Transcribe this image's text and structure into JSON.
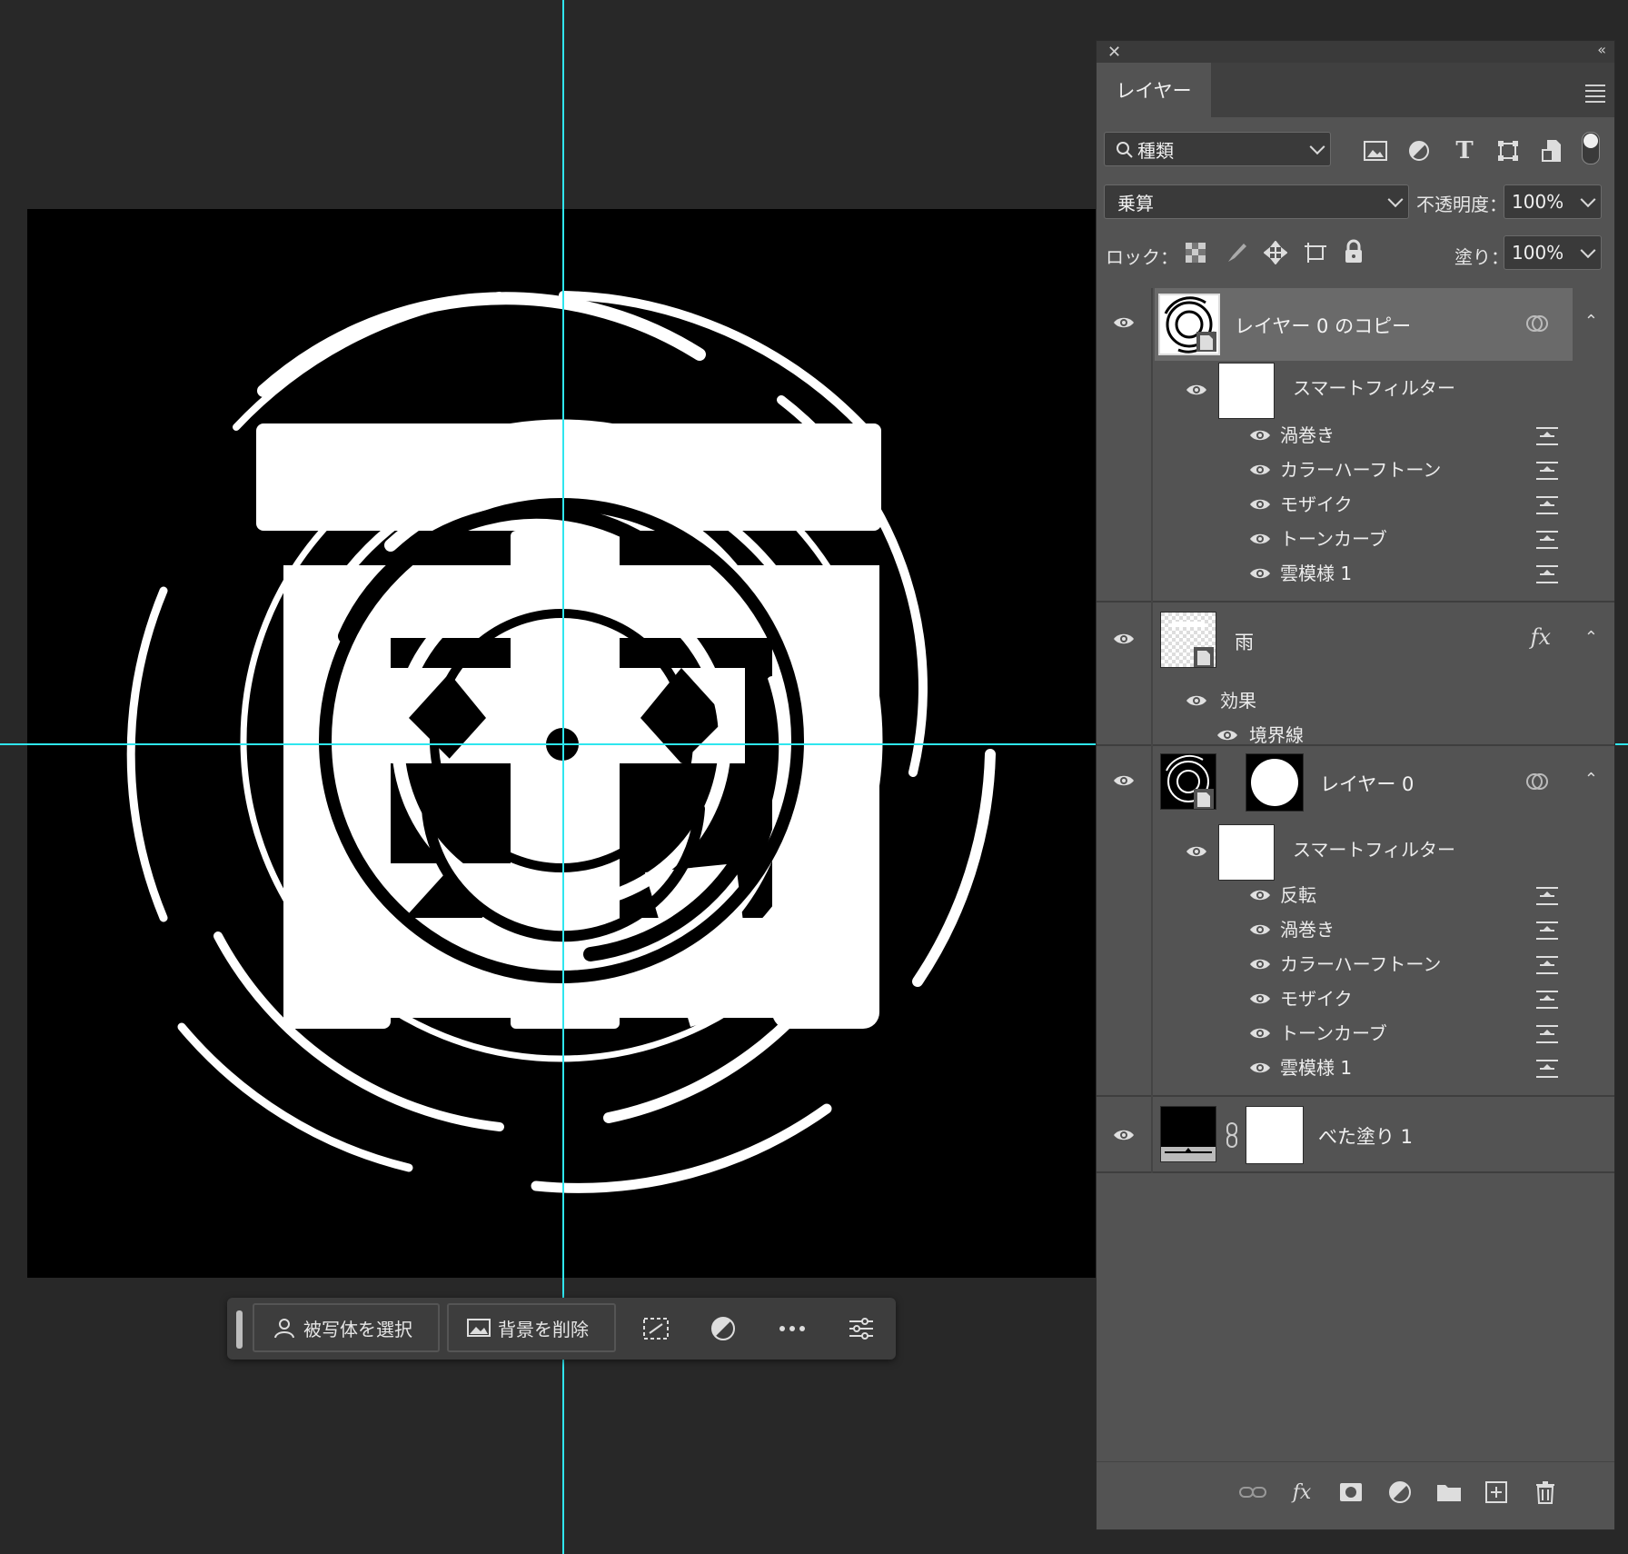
{
  "taskbar": {
    "select_subject_label": "被写体を選択",
    "remove_bg_label": "背景を削除"
  },
  "layers_panel": {
    "tab_label": "レイヤー",
    "filter_kind": "種類",
    "blend_mode": "乗算",
    "opacity_label": "不透明度：",
    "opacity_value": "100%",
    "lock_label": "ロック：",
    "fill_label": "塗り：",
    "fill_value": "100%",
    "layers": [
      {
        "name": "レイヤー 0 のコピー",
        "smart_filter_label": "スマートフィルター",
        "filters": [
          "渦巻き",
          "カラーハーフトーン",
          "モザイク",
          "トーンカーブ",
          "雲模様 1"
        ]
      },
      {
        "name": "雨",
        "effects_label": "効果",
        "effects": [
          "境界線"
        ],
        "fx_icon": "fx"
      },
      {
        "name": "レイヤー 0",
        "smart_filter_label": "スマートフィルター",
        "filters": [
          "反転",
          "渦巻き",
          "カラーハーフトーン",
          "モザイク",
          "トーンカーブ",
          "雲模様 1"
        ]
      },
      {
        "name": "べた塗り 1"
      }
    ],
    "bottom_fx": "fx"
  },
  "colors": {
    "guide": "#2fe6ef",
    "panel_bg": "#535353",
    "workspace_bg": "#282828"
  }
}
